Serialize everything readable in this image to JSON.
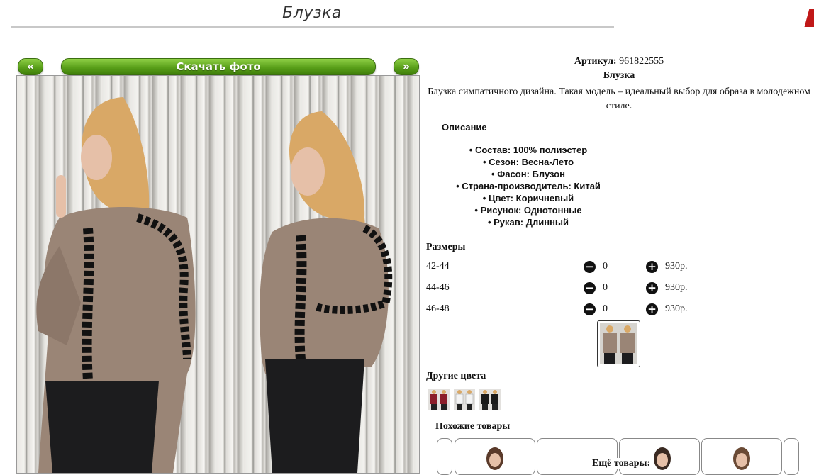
{
  "page": {
    "title": "Блузка"
  },
  "nav": {
    "prev_label": "«",
    "download_label": "Скачать фото",
    "next_label": "»"
  },
  "product": {
    "article_label": "Артикул:",
    "article_value": "961822555",
    "name": "Блузка",
    "description": "Блузка симпатичного дизайна. Такая модель – идеальный выбор для образа в молодежном стиле.",
    "description_heading": "Описание",
    "specs": [
      "Состав: 100% полиэстер",
      "Сезон: Весна-Лето",
      "Фасон: Блузон",
      "Страна-производитель: Китай",
      "Цвет: Коричневый",
      "Рисунок: Однотонные",
      "Рукав: Длинный"
    ]
  },
  "sizes": {
    "heading": "Размеры",
    "rows": [
      {
        "label": "42-44",
        "qty": "0",
        "price": "930р."
      },
      {
        "label": "44-46",
        "qty": "0",
        "price": "930р."
      },
      {
        "label": "46-48",
        "qty": "0",
        "price": "930р."
      }
    ],
    "minus_icon": "minus-circle-icon",
    "plus_icon": "plus-circle-icon"
  },
  "other_colors": {
    "heading": "Другие цвета",
    "swatches": [
      "#8b1e2a",
      "#ffffff",
      "#1a1a1a"
    ]
  },
  "similar": {
    "heading": "Похожие товары",
    "more_label": "Ещё товары:"
  },
  "colors": {
    "nav_green": "#5aa01a",
    "blouse_taupe": "#9a8576",
    "lace_black": "#111111"
  }
}
